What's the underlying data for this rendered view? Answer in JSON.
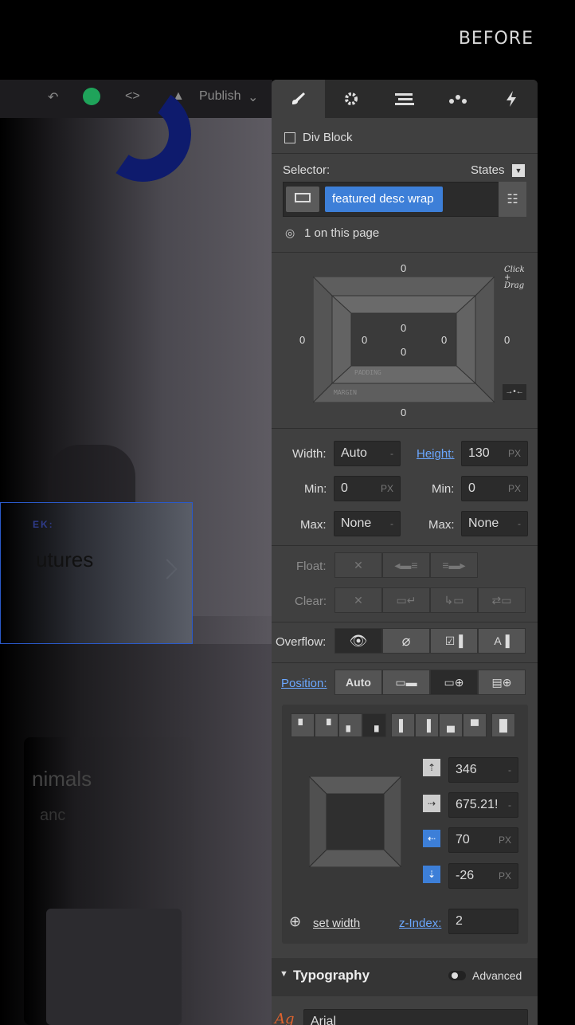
{
  "before_label": "BEFORE",
  "topbar": {
    "publish_label": "Publish"
  },
  "canvas": {
    "feature_title": "utures",
    "animal_title": "nimals"
  },
  "panel": {
    "tabs": [
      "brush-icon",
      "gear-icon",
      "navigator-icon",
      "drops-icon",
      "lightning-icon"
    ],
    "element_type": "Div Block",
    "selector_label": "Selector:",
    "states_label": "States",
    "class_name": "featured desc wrap",
    "on_page": "1 on this page",
    "box_model": {
      "margin_top": "0",
      "margin_right": "0",
      "margin_bottom": "0",
      "margin_left": "0",
      "padding_top": "0",
      "padding_right": "0",
      "padding_bottom": "0",
      "padding_left": "0",
      "padding_label": "PADDING",
      "margin_label": "MARGIN",
      "hint": "Click + Drag"
    },
    "size": {
      "width_label": "Width:",
      "width_value": "Auto",
      "height_label": "Height:",
      "height_value": "130",
      "height_unit": "PX",
      "min_label": "Min:",
      "min_w_value": "0",
      "min_w_unit": "PX",
      "min_h_label": "Min:",
      "min_h_value": "0",
      "min_h_unit": "PX",
      "max_label": "Max:",
      "max_w_value": "None",
      "max_h_label": "Max:",
      "max_h_value": "None"
    },
    "float_label": "Float:",
    "clear_label": "Clear:",
    "overflow_label": "Overflow:",
    "position_label": "Position:",
    "position_auto": "Auto",
    "offsets": {
      "top": "346",
      "left": "675.21!",
      "right": "70",
      "right_unit": "PX",
      "bottom": "-26",
      "bottom_unit": "PX"
    },
    "set_width": "set width",
    "z_index_label": "z-Index:",
    "z_index_value": "2",
    "typography_label": "Typography",
    "advanced_label": "Advanced",
    "font_value": "Arial"
  }
}
